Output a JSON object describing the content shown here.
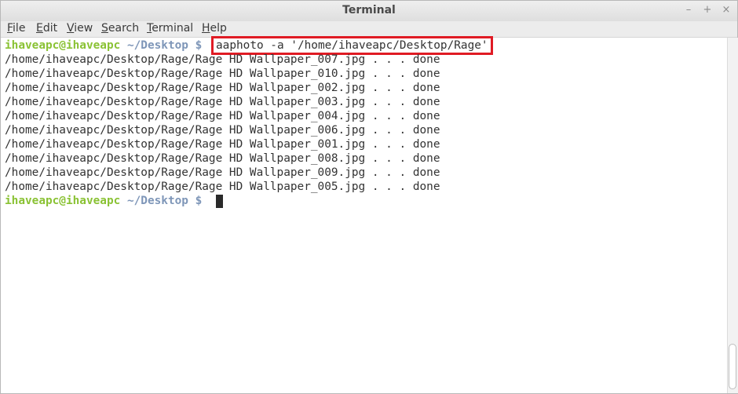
{
  "window": {
    "title": "Terminal",
    "controls": [
      "–",
      "+",
      "×"
    ]
  },
  "menu": [
    {
      "underline": "F",
      "rest": "ile"
    },
    {
      "underline": "E",
      "rest": "dit"
    },
    {
      "underline": "V",
      "rest": "iew"
    },
    {
      "underline": "S",
      "rest": "earch"
    },
    {
      "underline": "T",
      "rest": "erminal"
    },
    {
      "underline": "H",
      "rest": "elp"
    }
  ],
  "terminal": {
    "prompt_user": "ihaveapc@ihaveapc",
    "prompt_path": " ~/Desktop $",
    "command": "aaphoto -a '/home/ihaveapc/Desktop/Rage'",
    "output": [
      "/home/ihaveapc/Desktop/Rage/Rage HD Wallpaper_007.jpg . . . done",
      "/home/ihaveapc/Desktop/Rage/Rage HD Wallpaper_010.jpg . . . done",
      "/home/ihaveapc/Desktop/Rage/Rage HD Wallpaper_002.jpg . . . done",
      "/home/ihaveapc/Desktop/Rage/Rage HD Wallpaper_003.jpg . . . done",
      "/home/ihaveapc/Desktop/Rage/Rage HD Wallpaper_004.jpg . . . done",
      "/home/ihaveapc/Desktop/Rage/Rage HD Wallpaper_006.jpg . . . done",
      "/home/ihaveapc/Desktop/Rage/Rage HD Wallpaper_001.jpg . . . done",
      "/home/ihaveapc/Desktop/Rage/Rage HD Wallpaper_008.jpg . . . done",
      "/home/ihaveapc/Desktop/Rage/Rage HD Wallpaper_009.jpg . . . done",
      "/home/ihaveapc/Desktop/Rage/Rage HD Wallpaper_005.jpg . . . done"
    ]
  },
  "colors": {
    "prompt_user": "#8ac234",
    "prompt_path": "#7e96b8",
    "highlight_box": "#e01b24"
  },
  "icons": {
    "minimize": "minimize-icon",
    "maximize": "maximize-icon",
    "close": "close-icon"
  }
}
